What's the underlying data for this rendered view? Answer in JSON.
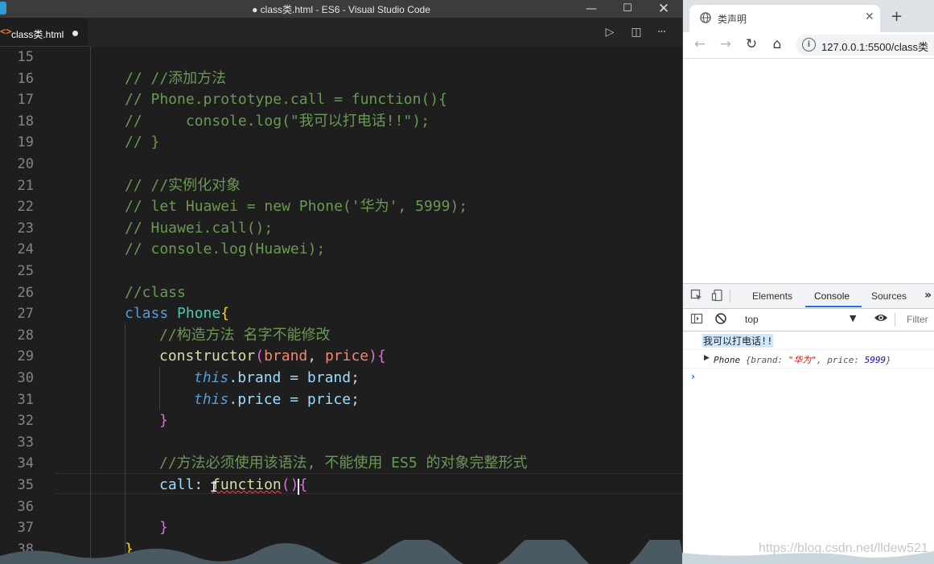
{
  "vscode": {
    "window_title": "● class类.html - ES6 - Visual Studio Code",
    "window_buttons": {
      "minimize": "—",
      "maximize": "☐",
      "close": "✕"
    },
    "tab": {
      "filename": "class类.html",
      "icon_glyph": "<>"
    },
    "tab_actions": {
      "run": "▷",
      "split": "◫",
      "more": "···"
    },
    "cursor_line": 35,
    "lines": [
      {
        "n": "15",
        "text": ""
      },
      {
        "n": "16",
        "text": "// //添加方法"
      },
      {
        "n": "17",
        "text": "// Phone.prototype.call = function(){"
      },
      {
        "n": "18",
        "text": "//     console.log(\"我可以打电话!!\");"
      },
      {
        "n": "19",
        "text": "// }"
      },
      {
        "n": "20",
        "text": ""
      },
      {
        "n": "21",
        "text": "// //实例化对象"
      },
      {
        "n": "22",
        "text": "// let Huawei = new Phone('华为', 5999);"
      },
      {
        "n": "23",
        "text": "// Huawei.call();"
      },
      {
        "n": "24",
        "text": "// console.log(Huawei);"
      },
      {
        "n": "25",
        "text": ""
      },
      {
        "n": "26",
        "text": "//class"
      },
      {
        "n": "27",
        "text": "class Phone{"
      },
      {
        "n": "28",
        "text": "//构造方法 名字不能修改"
      },
      {
        "n": "29",
        "text": "constructor(brand, price){"
      },
      {
        "n": "30",
        "text": "this.brand = brand;"
      },
      {
        "n": "31",
        "text": "this.price = price;"
      },
      {
        "n": "32",
        "text": "}"
      },
      {
        "n": "33",
        "text": ""
      },
      {
        "n": "34",
        "text": "//方法必须使用该语法, 不能使用 ES5 的对象完整形式"
      },
      {
        "n": "35",
        "text": "call: function(){"
      },
      {
        "n": "36",
        "text": ""
      },
      {
        "n": "37",
        "text": "}"
      },
      {
        "n": "38",
        "text": "}"
      }
    ],
    "tokens": {
      "l16": "// //添加方法",
      "l17": "// Phone.prototype.call = function(){",
      "l18": "//     console.log(\"我可以打电话!!\");",
      "l19": "// }",
      "l21": "// //实例化对象",
      "l22": "// let Huawei = new Phone('华为', 5999);",
      "l23": "// Huawei.call();",
      "l24": "// console.log(Huawei);",
      "l26": "//class",
      "kw_class": "class",
      "cls_phone": "Phone",
      "brace_open": "{",
      "l28": "//构造方法 名字不能修改",
      "fn_constructor": "constructor",
      "paren_open": "(",
      "p_brand": "brand",
      "comma": ", ",
      "p_price": "price",
      "paren_close_brace": "){",
      "kw_this": "this",
      "dot_brand_eq": ".brand = ",
      "v_brand": "brand",
      "semi": ";",
      "dot_price_eq": ".price = ",
      "v_price": "price",
      "brace_close": "}",
      "l34": "//方法必须使用该语法, 不能使用 ES5 的对象完整形式",
      "prop_call": "call",
      "colon": ": ",
      "kw_function": "function",
      "parens": "()",
      "brace_open2": "{",
      "brace_close2": "}",
      "brace_close3": "}"
    }
  },
  "browser": {
    "tab_title": "类声明",
    "tab_close": "✕",
    "new_tab": "+",
    "nav": {
      "back": "←",
      "forward": "→",
      "reload": "↻",
      "home": "⌂"
    },
    "info_glyph": "i",
    "url": "127.0.0.1:5500/class类",
    "devtools": {
      "tabs": [
        "Elements",
        "Console",
        "Sources"
      ],
      "active_tab": "Console",
      "more": "»",
      "context": "top",
      "filter_placeholder": "Filter",
      "console": {
        "message": "我可以打电话!!",
        "object_class": "Phone",
        "object_open": "{brand: ",
        "object_brand": "\"华为\"",
        "object_mid": ", price: ",
        "object_price": "5999",
        "object_close": "}",
        "prompt": "›"
      }
    },
    "watermark": "https://blog.csdn.net/lldew521"
  },
  "colors": {
    "editor_bg": "#1e1e1e",
    "comment": "#6a9955",
    "keyword": "#569cd6",
    "class_name": "#4ec9b0",
    "function_name": "#dcdcaa",
    "parameter": "#f48771",
    "property": "#9cdcfe",
    "devtools_accent": "#1a73e8"
  }
}
